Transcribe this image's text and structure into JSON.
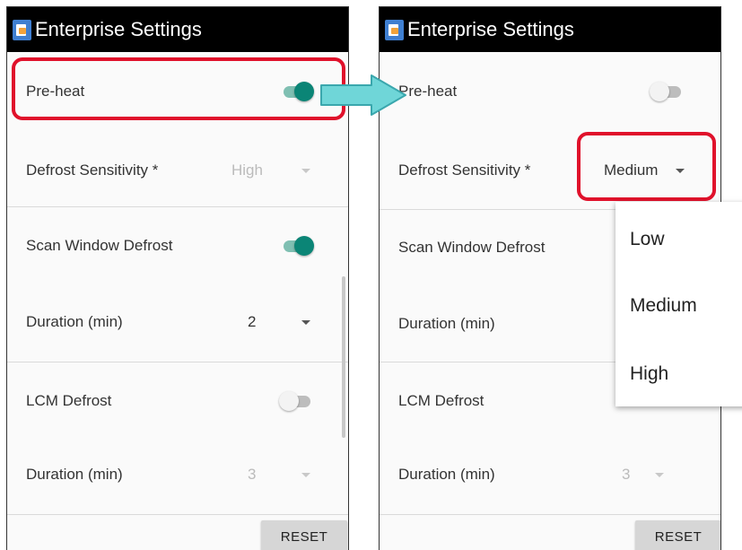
{
  "title": "Enterprise Settings",
  "accent_color": "#0b8576",
  "highlight_color": "#e0112b",
  "arrow_color": "#6fd6d8",
  "left_panel": {
    "preheat": {
      "label": "Pre-heat",
      "toggle": "on"
    },
    "defrost_sensitivity": {
      "label": "Defrost Sensitivity *",
      "value": "High",
      "enabled": false
    },
    "scan_window_defrost": {
      "label": "Scan Window Defrost",
      "toggle": "on"
    },
    "scan_duration": {
      "label": "Duration (min)",
      "value": "2",
      "enabled": true
    },
    "lcm_defrost": {
      "label": "LCM Defrost",
      "toggle": "off"
    },
    "lcm_duration": {
      "label": "Duration (min)",
      "value": "3",
      "enabled": false
    },
    "reset_label": "RESET"
  },
  "right_panel": {
    "preheat": {
      "label": "Pre-heat",
      "toggle": "off"
    },
    "defrost_sensitivity": {
      "label": "Defrost Sensitivity *",
      "value": "Medium",
      "enabled": true
    },
    "scan_window_defrost": {
      "label": "Scan Window Defrost"
    },
    "scan_duration": {
      "label": "Duration (min)"
    },
    "lcm_defrost": {
      "label": "LCM Defrost"
    },
    "lcm_duration": {
      "label": "Duration (min)",
      "value": "3",
      "enabled": false
    },
    "reset_label": "RESET"
  },
  "dropdown_options": [
    "Low",
    "Medium",
    "High"
  ],
  "dropdown_selected": "Medium"
}
